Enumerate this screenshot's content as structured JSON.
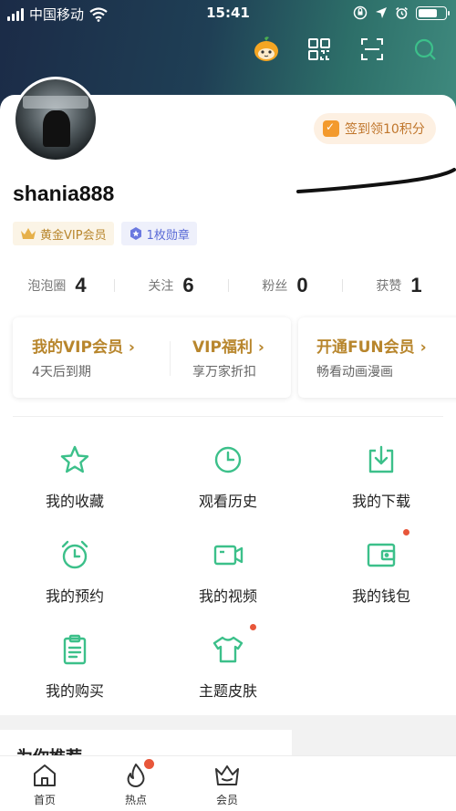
{
  "status_bar": {
    "carrier": "中国移动",
    "time": "15:41"
  },
  "checkin": {
    "label": "签到领10积分"
  },
  "profile": {
    "username": "shania888"
  },
  "badges": [
    {
      "label": "黄金VIP会员"
    },
    {
      "label": "1枚勋章"
    }
  ],
  "stats": [
    {
      "label": "泡泡圈",
      "value": "4"
    },
    {
      "label": "关注",
      "value": "6"
    },
    {
      "label": "粉丝",
      "value": "0"
    },
    {
      "label": "获赞",
      "value": "1"
    }
  ],
  "vip": [
    {
      "title": "我的VIP会员 ›",
      "subtitle": "4天后到期"
    },
    {
      "title": "VIP福利 ›",
      "subtitle": "享万家折扣"
    },
    {
      "title": "开通FUN会员 ›",
      "subtitle": "畅看动画漫画"
    }
  ],
  "grid": [
    {
      "label": "我的收藏",
      "icon": "star-icon"
    },
    {
      "label": "观看历史",
      "icon": "clock-icon"
    },
    {
      "label": "我的下载",
      "icon": "download-icon"
    },
    {
      "label": "我的预约",
      "icon": "alarm-clock-icon"
    },
    {
      "label": "我的视频",
      "icon": "video-camera-icon"
    },
    {
      "label": "我的钱包",
      "icon": "wallet-icon"
    },
    {
      "label": "我的购买",
      "icon": "clipboard-icon"
    },
    {
      "label": "主题皮肤",
      "icon": "tshirt-icon"
    }
  ],
  "recommend": {
    "title": "为你推荐"
  },
  "tabs": [
    {
      "label": "首页",
      "icon": "home-icon"
    },
    {
      "label": "热点",
      "icon": "flame-icon"
    },
    {
      "label": "会员",
      "icon": "crown-icon"
    }
  ],
  "colors": {
    "accent_green": "#3cc08a",
    "gold": "#b8862d",
    "red_dot": "#e8563a"
  }
}
